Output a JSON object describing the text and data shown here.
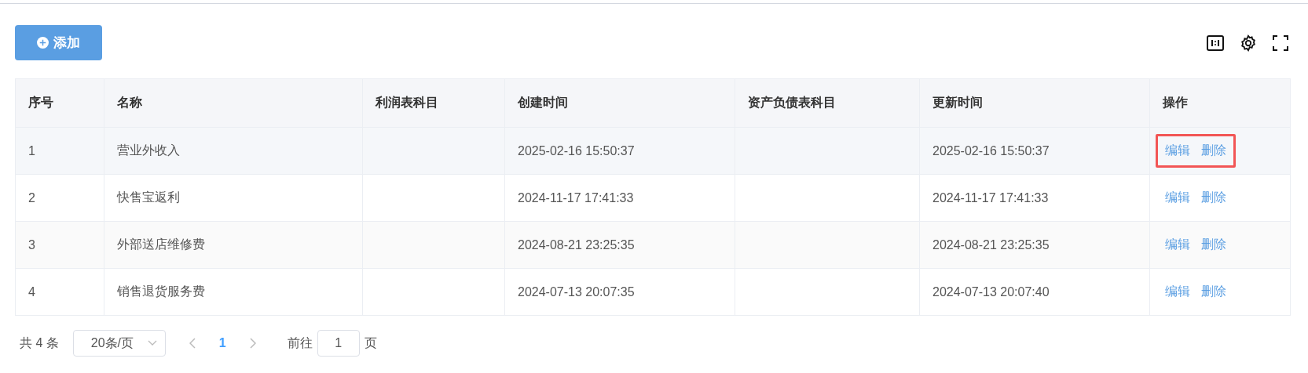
{
  "toolbar": {
    "add_button": "添加"
  },
  "table": {
    "columns": [
      "序号",
      "名称",
      "利润表科目",
      "创建时间",
      "资产负债表科目",
      "更新时间",
      "操作"
    ],
    "rows": [
      {
        "index": "1",
        "name": "营业外收入",
        "created": "2025-02-16 15:50:37",
        "updated": "2025-02-16 15:50:37",
        "actions": [
          "编辑",
          "删除"
        ],
        "hovered": true,
        "highlighted": true
      },
      {
        "index": "2",
        "name": "快售宝返利",
        "created": "2024-11-17 17:41:33",
        "updated": "2024-11-17 17:41:33",
        "actions": [
          "编辑",
          "删除"
        ],
        "hovered": false,
        "highlighted": false
      },
      {
        "index": "3",
        "name": "外部送店维修费",
        "created": "2024-08-21 23:25:35",
        "updated": "2024-08-21 23:25:35",
        "actions": [
          "编辑",
          "删除"
        ],
        "hovered": false,
        "highlighted": false
      },
      {
        "index": "4",
        "name": "销售退货服务费",
        "created": "2024-07-13 20:07:35",
        "updated": "2024-07-13 20:07:40",
        "actions": [
          "编辑",
          "删除"
        ],
        "hovered": false,
        "highlighted": false
      }
    ]
  },
  "pagination": {
    "total": "共 4 条",
    "page_size": "20条/页",
    "pages": [
      {
        "label": "1",
        "selected": true
      }
    ],
    "goto_label": "前往",
    "goto_value": "1",
    "goto_suffix": "页"
  }
}
